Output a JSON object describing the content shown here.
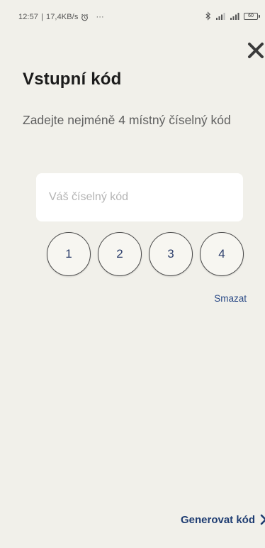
{
  "status_bar": {
    "time": "12:57",
    "net_speed": "17,4KB/s",
    "more": "···",
    "battery": "60"
  },
  "screen": {
    "title": "Vstupní kód",
    "subtitle": "Zadejte nejméně 4 místný číselný kód"
  },
  "code_input": {
    "placeholder": "Váš číselný kód",
    "value": ""
  },
  "digits": [
    "1",
    "2",
    "3",
    "4"
  ],
  "actions": {
    "delete_label": "Smazat",
    "generate_label": "Generovat kód"
  },
  "colors": {
    "background": "#f1f0ea",
    "accent": "#1f3d72",
    "link": "#2b4a86"
  }
}
